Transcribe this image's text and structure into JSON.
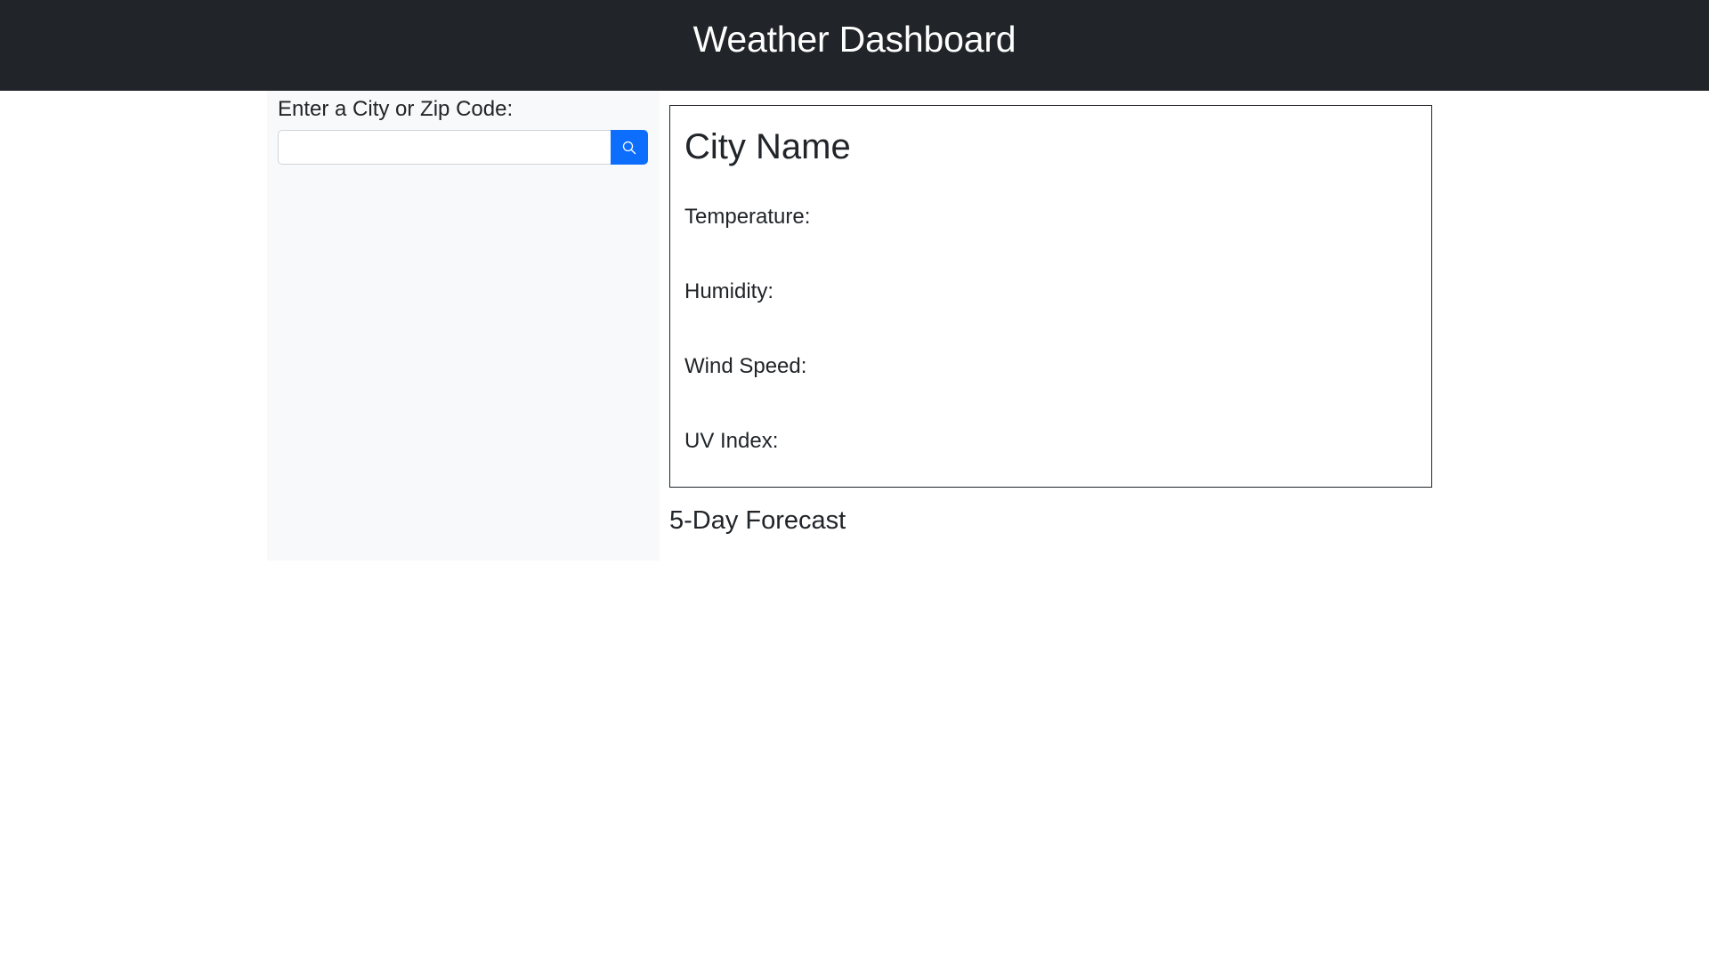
{
  "header": {
    "title": "Weather Dashboard"
  },
  "sidebar": {
    "search_label": "Enter a City or Zip Code:",
    "search_value": "",
    "search_placeholder": "",
    "search_button_icon": "search-icon"
  },
  "current": {
    "city_name": "City Name",
    "temperature_label": "Temperature:",
    "humidity_label": "Humidity:",
    "wind_speed_label": "Wind Speed:",
    "uv_index_label": "UV Index:"
  },
  "forecast": {
    "title": "5-Day Forecast"
  },
  "colors": {
    "navbar": "#212529",
    "sidebar": "#f8f9fa",
    "accent": "#0d6efd"
  }
}
